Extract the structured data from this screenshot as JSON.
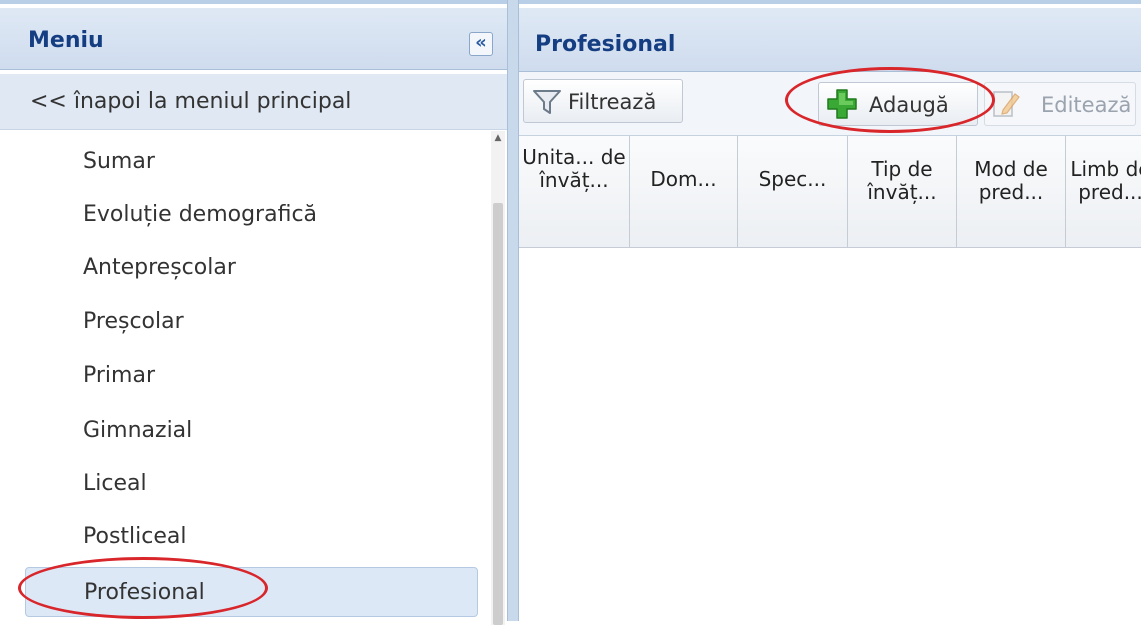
{
  "left_panel": {
    "title": "Meniu",
    "collapse_glyph": "«",
    "back_link": "<< înapoi la meniul principal",
    "items": [
      {
        "label": "Sumar"
      },
      {
        "label": "Evoluție demografică"
      },
      {
        "label": "Antepreșcolar"
      },
      {
        "label": "Preșcolar"
      },
      {
        "label": "Primar"
      },
      {
        "label": "Gimnazial"
      },
      {
        "label": "Liceal"
      },
      {
        "label": "Postliceal"
      },
      {
        "label": "Profesional"
      }
    ],
    "selected_item": "Profesional"
  },
  "right_panel": {
    "title": "Profesional",
    "toolbar": {
      "filter_label": "Filtrează",
      "add_label": "Adaugă",
      "edit_label": "Editează"
    },
    "columns": [
      {
        "label": "Unita... de învăț..."
      },
      {
        "label": "Dom..."
      },
      {
        "label": "Spec..."
      },
      {
        "label": "Tip de învăț..."
      },
      {
        "label": "Mod de pred..."
      },
      {
        "label": "Limb de pred..."
      }
    ]
  },
  "colors": {
    "title_blue": "#153e82",
    "header_bg": "#cfdcee",
    "selected_bg": "#dde8f6",
    "annotation_red": "#d8262b",
    "add_icon_green": "#3aa835"
  },
  "icons": {
    "collapse": "double-chevron-left-icon",
    "filter": "funnel-icon",
    "add": "green-plus-icon",
    "edit": "edit-pencil-icon"
  }
}
